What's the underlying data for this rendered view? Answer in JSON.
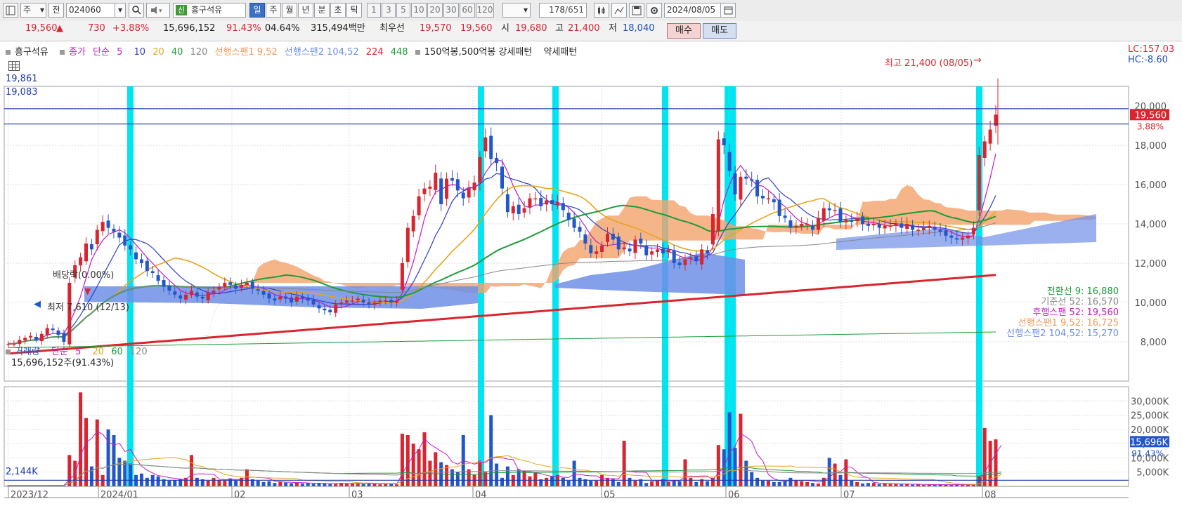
{
  "toolbar": {
    "market_type": "주",
    "prev_label": "전",
    "code": "024060",
    "sin_badge": "신",
    "stock_name": "흥구석유",
    "periods": [
      "일",
      "주",
      "월",
      "년",
      "분",
      "초",
      "틱"
    ],
    "active_period": "일",
    "intervals": [
      "1",
      "3",
      "5",
      "10",
      "20",
      "30",
      "60",
      "120"
    ],
    "count_value": "178",
    "count_total": "/651",
    "date": "2024/08/05"
  },
  "quote": {
    "price": "19,560",
    "change_arrow": "▲",
    "change": "730",
    "change_pct": "+3.88%",
    "volume": "15,696,152",
    "volume_ratio": "91.43%",
    "turnover": "04.64%",
    "amount": "315,494백만",
    "best_label": "최우선",
    "ask": "19,570",
    "bid": "19,560",
    "open_label": "시",
    "open": "19,680",
    "high_label": "고",
    "high": "21,400",
    "low_label": "저",
    "low": "18,040",
    "buy_label": "매수",
    "sell_label": "매도"
  },
  "legend_price": {
    "name": "흥구석유",
    "close_label": "종가",
    "simple_label": "단순",
    "ma": [
      "5",
      "10",
      "20",
      "40",
      "120"
    ],
    "span1": "선행스팬1 9,52",
    "span2": "선행스팬2 104,52",
    "ma224": "224",
    "ma448": "448",
    "pattern": "150억봉,500억봉 강세패턴",
    "weak": "약세패턴"
  },
  "legend_volume": {
    "name": "거래량",
    "simple_label": "단순",
    "ma": [
      "5",
      "20",
      "60",
      "120"
    ],
    "value": "15,696,152주(91.43%)"
  },
  "annotations": {
    "max_label": "최고 21,400 (08/05)",
    "min_label": "최저 7,610 (12/13)",
    "dividend": "배당락(0.00%)",
    "line1": "19,861",
    "line2": "19,083",
    "vol_line": "2,144K",
    "lc": "LC:157.03",
    "hc": "HC:-8.60"
  },
  "ichimoku": [
    "전환선 9: 16,880",
    "기준선 52: 16,570",
    "후행스팬 52: 19,560",
    "선행스팬1 9,52: 16,725",
    "선행스팬2 104,52: 15,270"
  ],
  "colors": {
    "up": "#d8252f",
    "down": "#2357c9",
    "highlight": "#00e5f0",
    "cloud_up": "#f4a26c",
    "cloud_down": "#6f8fe8"
  },
  "chart_data": [
    {
      "type": "candlestick",
      "title": "흥구석유",
      "x": [
        "2023/12",
        "2024/01",
        "02",
        "03",
        "04",
        "05",
        "06",
        "07",
        "08"
      ],
      "ylim": [
        6000,
        21000
      ],
      "y_ticks": [
        8000,
        10000,
        12000,
        14000,
        16000,
        18000,
        20000
      ],
      "last_price": 19560,
      "last_change_pct": "3.88%",
      "series": [
        {
          "name": "종가",
          "values": [
            7900,
            7900,
            8100,
            8200,
            8300,
            8100,
            8400,
            8700,
            8600,
            8350,
            8000,
            11000,
            11900,
            12300,
            13000,
            12700,
            13700,
            14100,
            13800,
            13600,
            13300,
            12900,
            12700,
            12200,
            12000,
            11600,
            11500,
            11100,
            10800,
            10600,
            10400,
            10200,
            10400,
            10600,
            10300,
            10200,
            10500,
            10600,
            10800,
            11000,
            10900,
            10700,
            10900,
            11000,
            10700,
            10600,
            10400,
            10200,
            10100,
            10300,
            10200,
            10000,
            10300,
            10200,
            10100,
            9900,
            9700,
            9600,
            9500,
            9900,
            10000,
            10100,
            10100,
            10200,
            10000,
            9900,
            10000,
            10100,
            10100,
            10000,
            10100,
            12000,
            13800,
            14400,
            15400,
            15800,
            15900,
            16600,
            15000,
            16300,
            16200,
            15700,
            15300,
            15800,
            16100,
            17400,
            18400,
            17300,
            17100,
            15800,
            14600,
            14900,
            14500,
            14800,
            15300,
            15300,
            14900,
            15200,
            15000,
            15100,
            14700,
            14200,
            13800,
            13600,
            13000,
            12500,
            12600,
            12900,
            13500,
            13200,
            12700,
            12800,
            12600,
            13200,
            13000,
            12400,
            12600,
            12700,
            12500,
            12700,
            12000,
            11900,
            12200,
            12300,
            12100,
            12700,
            12500,
            14500,
            18300,
            18000,
            16700,
            15500,
            16400,
            16300,
            16200,
            15400,
            15300,
            15300,
            15100,
            14400,
            14300,
            13800,
            13900,
            14000,
            14000,
            13700,
            14300,
            14800,
            14700,
            14700,
            14100,
            14200,
            14100,
            14300,
            14000,
            13900,
            14000,
            13800,
            13900,
            13900,
            14000,
            13800,
            14000,
            13700,
            13700,
            13800,
            13900,
            13700,
            13600,
            13400,
            13300,
            13200,
            13300,
            13400,
            13800,
            17500,
            18200,
            18800,
            19560
          ]
        },
        {
          "name": "5",
          "values": []
        },
        {
          "name": "10",
          "values": []
        },
        {
          "name": "20",
          "values": []
        },
        {
          "name": "40",
          "values": []
        },
        {
          "name": "120",
          "values": []
        },
        {
          "name": "224",
          "values": []
        },
        {
          "name": "448",
          "values": []
        }
      ]
    },
    {
      "type": "bar",
      "title": "거래량",
      "x": [
        "2023/12",
        "2024/01",
        "02",
        "03",
        "04",
        "05",
        "06",
        "07",
        "08"
      ],
      "y_ticks": [
        "5,000K",
        "10,000K",
        "15,000K",
        "20,000K",
        "25,000K",
        "30,000K"
      ],
      "ylim": [
        0,
        35000
      ],
      "last_value_label": "15,696K",
      "last_value_ratio": "91.43%",
      "reference_line": 2144,
      "values_k": [
        300,
        250,
        300,
        260,
        280,
        300,
        250,
        300,
        320,
        290,
        260,
        11000,
        9000,
        33000,
        24000,
        7000,
        23500,
        4000,
        20000,
        18000,
        10000,
        9000,
        8000,
        4000,
        4500,
        3000,
        4000,
        3500,
        2500,
        2000,
        2200,
        2500,
        3000,
        11000,
        3000,
        2500,
        2000,
        3000,
        2200,
        2000,
        2800,
        2000,
        3000,
        6000,
        2500,
        2000,
        1500,
        1800,
        1200,
        1600,
        1300,
        1100,
        1400,
        1000,
        1200,
        900,
        1100,
        1000,
        800,
        1000,
        1200,
        1100,
        1000,
        900,
        800,
        1100,
        900,
        700,
        800,
        1000,
        700,
        18500,
        18000,
        15000,
        13000,
        19000,
        9000,
        12000,
        8500,
        7500,
        6000,
        5000,
        18000,
        6000,
        4000,
        9000,
        5000,
        25000,
        8000,
        3000,
        7000,
        4000,
        6000,
        5500,
        3500,
        5000,
        2500,
        3000,
        3500,
        4000,
        3000,
        2000,
        9000,
        3000,
        2500,
        2000,
        2000,
        4000,
        3000,
        2500,
        1500,
        16000,
        3000,
        2000,
        2500,
        1200,
        1800,
        2000,
        2500,
        1500,
        2000,
        1800,
        9500,
        3000,
        1500,
        2500,
        1800,
        3000,
        14500,
        13000,
        26000,
        13500,
        25500,
        9000,
        5000,
        3000,
        2000,
        2000,
        1500,
        1500,
        2000,
        3000,
        2000,
        1800,
        1500,
        1200,
        1000,
        3000,
        10000,
        8000,
        4000,
        9500,
        2000,
        1500,
        1000,
        1200,
        1200,
        800,
        1000,
        800,
        900,
        700,
        800,
        600,
        700,
        500,
        600,
        500,
        700,
        600,
        500,
        700,
        500,
        500,
        600,
        3500,
        20500,
        16000,
        16500,
        15700
      ]
    }
  ]
}
